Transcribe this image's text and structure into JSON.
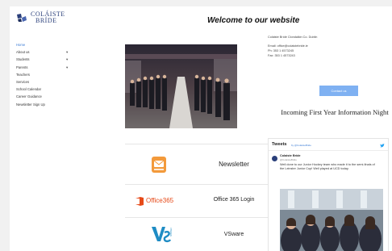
{
  "logo": {
    "line1": "COLÁISTE",
    "line2": "BRÍDE"
  },
  "nav": {
    "items": [
      {
        "label": "Home",
        "active": true,
        "caret": ""
      },
      {
        "label": "About us",
        "caret": "▾"
      },
      {
        "label": "Students",
        "caret": "▾"
      },
      {
        "label": "Parents",
        "caret": "▾"
      },
      {
        "label": "Teachers",
        "caret": ""
      },
      {
        "label": "Services",
        "caret": ""
      },
      {
        "label": "School Calendar",
        "caret": ""
      },
      {
        "label": "Career Guidance",
        "caret": ""
      },
      {
        "label": "Newsletter Sign Up",
        "caret": ""
      }
    ]
  },
  "page_title": "Welcome to our website",
  "contact": {
    "address": "Coláiste Bríde Clondalkin Co. Dublin",
    "email": "Email: office@colaistebride.ie",
    "phone": "Ph: 353 1 4573245",
    "fax": "Fax: 353 1 4573243",
    "button": "Contact us"
  },
  "incoming_label": "Incoming First Year Information Night",
  "tiles": [
    {
      "name": "newsletter",
      "label": "Newsletter"
    },
    {
      "name": "office365",
      "label": "Office 365 Login",
      "brand": "Office365"
    },
    {
      "name": "vsware",
      "label": "VSware",
      "brand": "VSWARE"
    }
  ],
  "tweets": {
    "heading": "Tweets",
    "by": "by @ColaisteBride",
    "author": "Colaiste Bride",
    "handle": "@ColaisteBride",
    "text": "Well done to our Junior Hockey team who made it to the semi-finals of the Leinster Junior Cup! Well played at UCD today."
  },
  "colors": {
    "accent": "#7fb1f2",
    "link": "#3a7bd5",
    "brand_navy": "#2a3f7a",
    "office_red": "#e64a19",
    "newsletter_orange": "#f39a3b"
  }
}
